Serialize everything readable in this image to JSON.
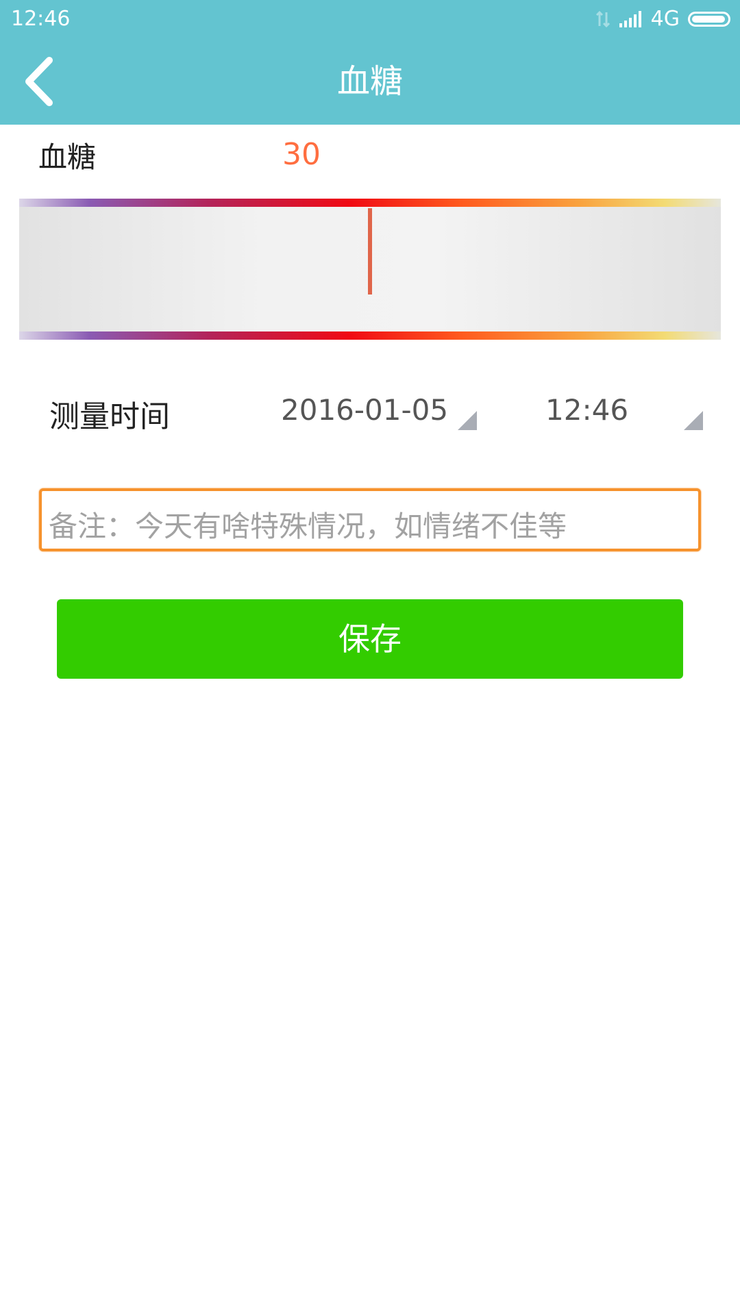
{
  "status_bar": {
    "time": "12:46",
    "network": "4G",
    "icons": [
      "data-transfer-icon",
      "signal-icon",
      "battery-icon"
    ],
    "battery_level": 0.95
  },
  "header": {
    "title": "血糖",
    "back_icon": "chevron-left-icon"
  },
  "reading": {
    "label": "血糖",
    "value": "30"
  },
  "ruler": {
    "indicator_color": "#e0654a"
  },
  "measure_time": {
    "label": "测量时间",
    "date": "2016-01-05",
    "time": "12:46"
  },
  "note": {
    "placeholder": "备注：今天有啥特殊情况，如情绪不佳等",
    "value": ""
  },
  "actions": {
    "save_label": "保存"
  },
  "colors": {
    "header_bg": "#63c4d0",
    "accent_value": "#ff6e40",
    "save_button": "#33cc00",
    "input_focus_border": "#f6922d"
  }
}
